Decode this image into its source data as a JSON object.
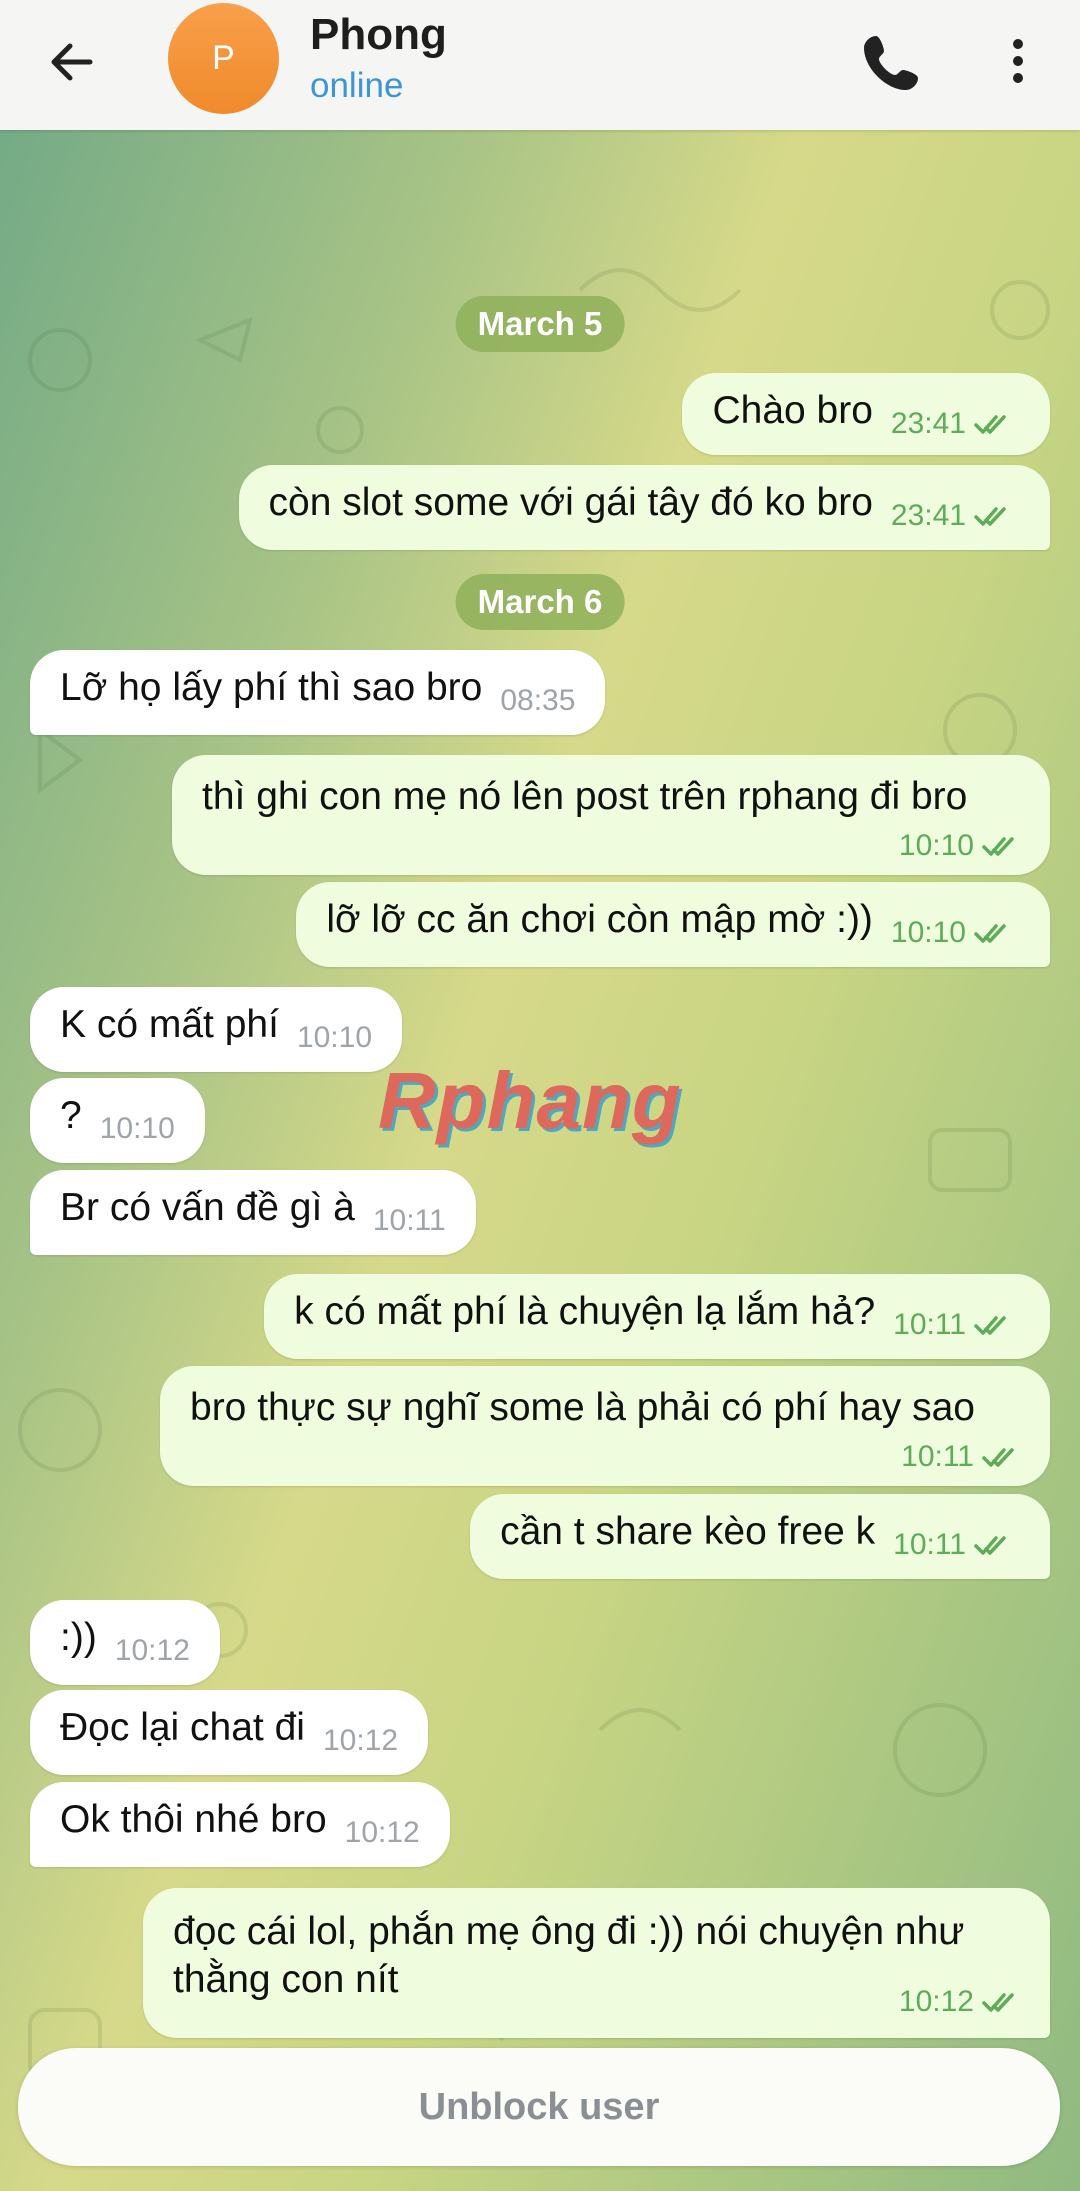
{
  "header": {
    "avatar_letter": "P",
    "contact_name": "Phong",
    "status": "online"
  },
  "watermark": "Rphang",
  "messages": [
    {
      "type": "date",
      "text": "March 5"
    },
    {
      "type": "out",
      "text": "Chào bro",
      "time": "23:41"
    },
    {
      "type": "out",
      "text": "còn slot some với gái tây đó ko bro",
      "time": "23:41"
    },
    {
      "type": "date",
      "text": "March 6"
    },
    {
      "type": "in",
      "text": "Lỡ họ lấy phí thì sao bro",
      "time": "08:35"
    },
    {
      "type": "out",
      "text": "thì ghi con mẹ nó lên post trên rphang đi bro",
      "time": "10:10"
    },
    {
      "type": "out",
      "text": "lỡ lỡ cc ăn chơi còn mập mờ :))",
      "time": "10:10"
    },
    {
      "type": "in",
      "text": "K có mất phí",
      "time": "10:10"
    },
    {
      "type": "in",
      "text": "?",
      "time": "10:10"
    },
    {
      "type": "in",
      "text": "Br có vấn đề gì à",
      "time": "10:11"
    },
    {
      "type": "out",
      "text": "k có mất phí là chuyện lạ lắm hả?",
      "time": "10:11"
    },
    {
      "type": "out",
      "text": "bro thực sự nghĩ some là phải có phí hay sao",
      "time": "10:11"
    },
    {
      "type": "out",
      "text": "cần t share kèo free k",
      "time": "10:11"
    },
    {
      "type": "in",
      "text": ":))",
      "time": "10:12"
    },
    {
      "type": "in",
      "text": "Đọc lại chat đi",
      "time": "10:12"
    },
    {
      "type": "in",
      "text": "Ok thôi nhé bro",
      "time": "10:12"
    },
    {
      "type": "out",
      "text": "đọc cái lol, phắn mẹ ông đi :)) nói chuyện như thằng con nít",
      "time": "10:12"
    }
  ],
  "footer": {
    "unblock_label": "Unblock user"
  },
  "colors": {
    "outgoing_bubble": "#effdde",
    "incoming_bubble": "#ffffff",
    "read_check": "#5eab58",
    "status_online": "#3d95d6",
    "avatar": "#f39433"
  }
}
